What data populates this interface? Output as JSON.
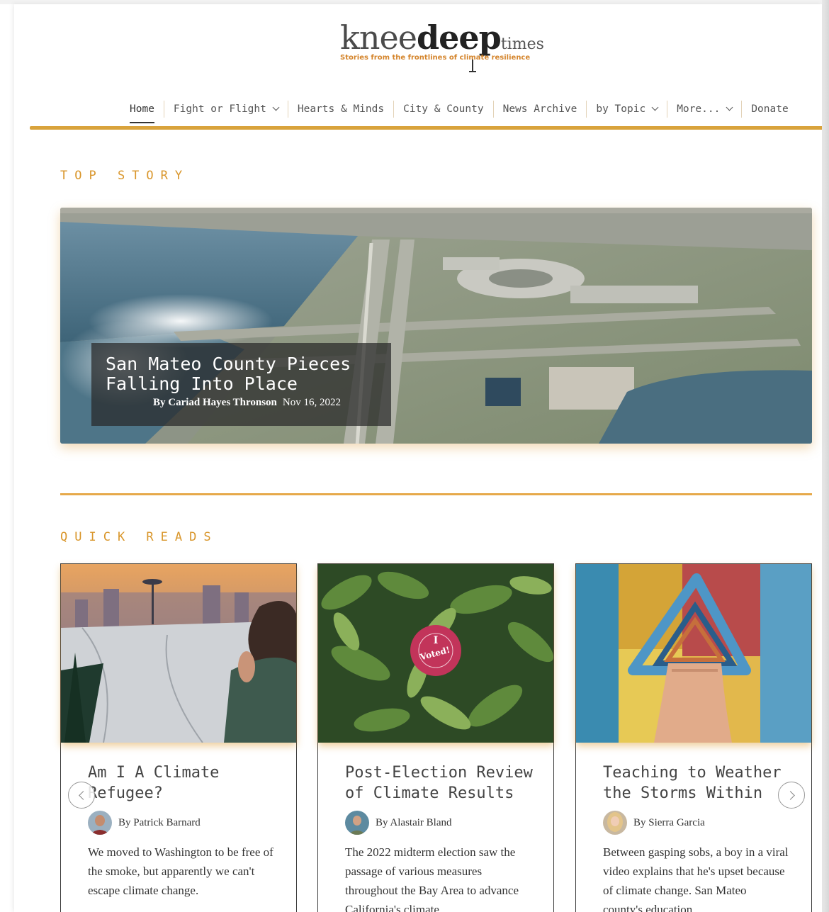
{
  "logo": {
    "word_knee": "knee",
    "word_deep": "deep",
    "word_times": "times",
    "tagline": "Stories from the frontlines of climate resilience"
  },
  "nav": {
    "items": [
      {
        "label": "Home",
        "active": true,
        "dropdown": false
      },
      {
        "label": "Fight or Flight",
        "dropdown": true
      },
      {
        "label": "Hearts & Minds",
        "dropdown": false
      },
      {
        "label": "City & County",
        "dropdown": false
      },
      {
        "label": "News Archive",
        "dropdown": false
      },
      {
        "label": "by Topic",
        "dropdown": true
      },
      {
        "label": "More...",
        "dropdown": true
      },
      {
        "label": "Donate",
        "dropdown": false
      }
    ]
  },
  "top_story": {
    "heading": "TOP STORY",
    "title": "San Mateo County Pieces Falling Into Place",
    "author": "By Cariad Hayes Thronson",
    "date": "Nov 16, 2022"
  },
  "quick_reads": {
    "heading": "QUICK READS",
    "cards": [
      {
        "title": "Am I A Climate Refugee?",
        "author": "By Patrick Barnard",
        "excerpt": "We moved to Washington to be free of the smoke, but apparently we can't escape climate change."
      },
      {
        "title": "Post-Election Review of Climate Results",
        "author": "By Alastair Bland",
        "excerpt": "The 2022 midterm election saw the passage of various measures throughout the Bay Area to advance California's climate"
      },
      {
        "title": "Teaching to Weather the Storms Within",
        "author": "By Sierra Garcia",
        "excerpt": "Between gasping sobs, a boy in a viral video explains that he's upset because of climate change. San Mateo county's education"
      }
    ]
  },
  "colors": {
    "accent": "#d9a33c",
    "heading": "#d9962b"
  }
}
